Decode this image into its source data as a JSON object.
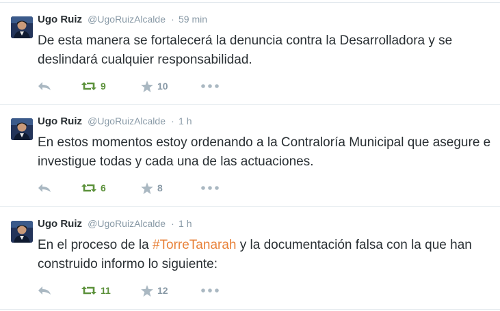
{
  "colors": {
    "name": "#292f33",
    "meta": "#8899a6",
    "hashtag": "#e8823a",
    "retweet_active": "#5c913b",
    "icon_grey": "#aab8c2",
    "divider": "#e1e8ed"
  },
  "icons": {
    "reply": "reply-icon",
    "retweet": "retweet-icon",
    "favorite": "star-icon",
    "more": "more-dots-icon"
  },
  "tweets": [
    {
      "fullname": "Ugo Ruiz",
      "username": "@UgoRuizAlcalde",
      "separator": "·",
      "time": "59 min",
      "text": "De esta manera se fortalecerá la denuncia contra la Desarrolladora y se deslindará cualquier responsabilidad.",
      "retweets": "9",
      "favorites": "10"
    },
    {
      "fullname": "Ugo Ruiz",
      "username": "@UgoRuizAlcalde",
      "separator": "·",
      "time": "1 h",
      "text": "En estos momentos estoy ordenando a la Contraloría Municipal que asegure e investigue todas y cada una de las actuaciones.",
      "retweets": "6",
      "favorites": "8"
    },
    {
      "fullname": "Ugo Ruiz",
      "username": "@UgoRuizAlcalde",
      "separator": "·",
      "time": "1 h",
      "text_before": "En el proceso de la ",
      "hashtag": "#TorreTanarah",
      "text_after": " y la documentación falsa con la que han construido informo lo siguiente:",
      "retweets": "11",
      "favorites": "12"
    }
  ]
}
